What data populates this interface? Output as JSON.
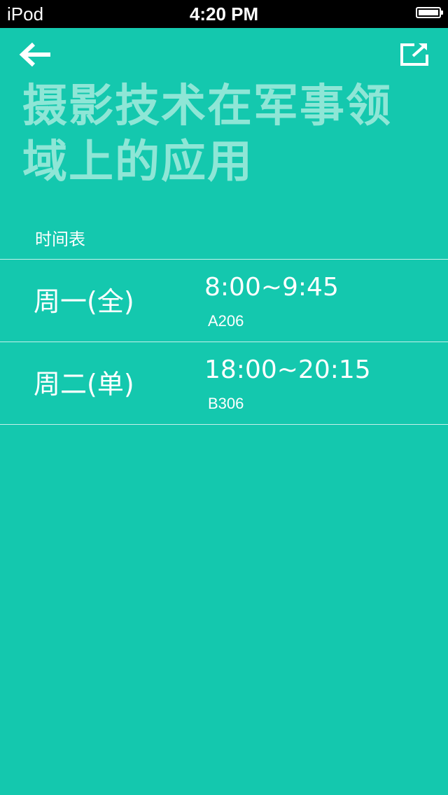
{
  "status_bar": {
    "device": "iPod",
    "time": "4:20 PM"
  },
  "header": {
    "back_icon": "arrow-left-icon",
    "share_icon": "share-external-icon",
    "title": "摄影技术在军事领域上的应用"
  },
  "schedule": {
    "label": "时间表",
    "rows": [
      {
        "day": "周一(全)",
        "time": "8:00~9:45",
        "room": "A206"
      },
      {
        "day": "周二(单)",
        "time": "18:00~20:15",
        "room": "B306"
      }
    ]
  },
  "colors": {
    "background": "#14c8ae",
    "title": "#8ee6d6",
    "text": "#ffffff"
  }
}
